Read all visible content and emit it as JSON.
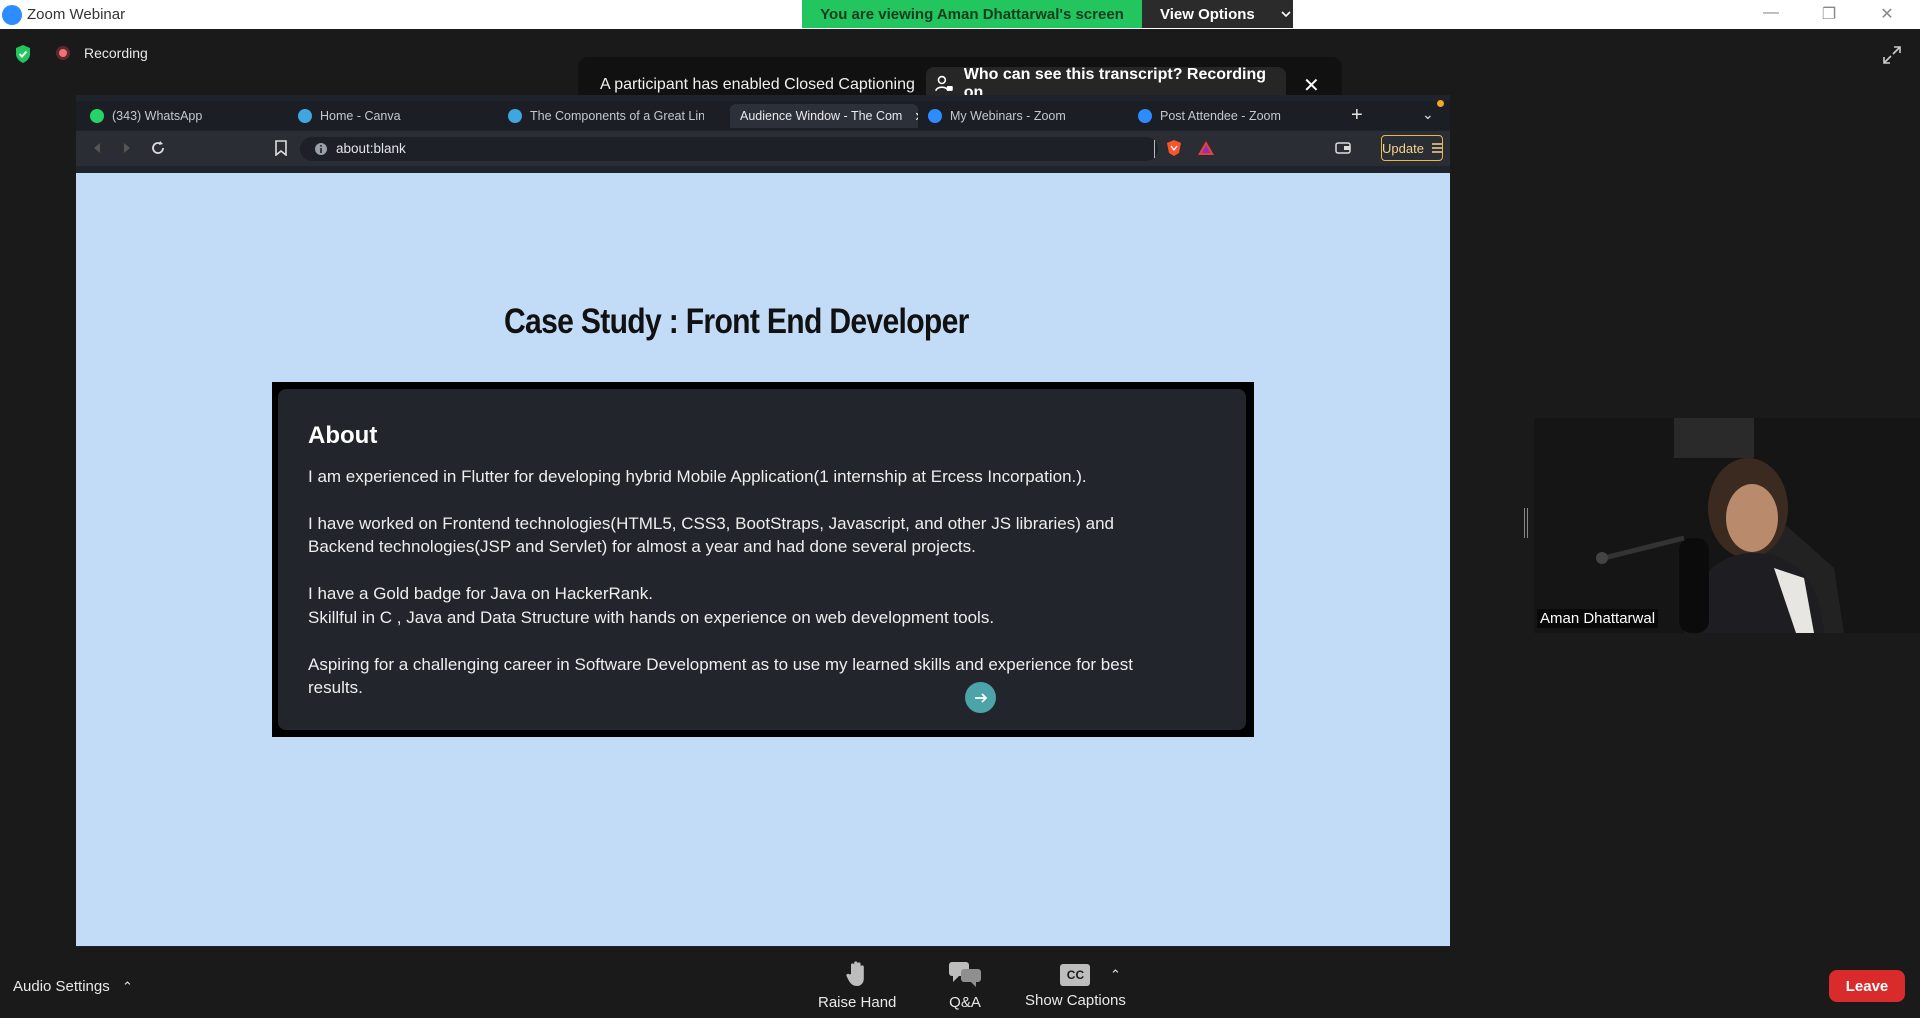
{
  "window": {
    "title": "Zoom Webinar",
    "share_banner": "You are viewing Aman Dhattarwal's screen",
    "view_options": "View Options",
    "minimize": "—",
    "restore": "❐",
    "close": "✕"
  },
  "recording": {
    "label": "Recording"
  },
  "cc_notice": {
    "message": "A participant has enabled Closed Captioning",
    "who_can_see": "Who can see this transcript? Recording on",
    "close": "✕"
  },
  "browser": {
    "tabs": [
      {
        "label": "(343) WhatsApp",
        "color": "#25d366"
      },
      {
        "label": "Home - Canva",
        "color": "#3fa7e0"
      },
      {
        "label": "The Components of a Great Link",
        "color": "#3fa7e0"
      },
      {
        "label": "Audience Window - The Com",
        "color": "#2d8cff"
      },
      {
        "label": "My Webinars - Zoom",
        "color": "#2d8cff"
      },
      {
        "label": "Post Attendee - Zoom",
        "color": "#2d8cff"
      }
    ],
    "active_tab_index": 3,
    "new_tab": "+",
    "tab_menu": "⌄",
    "address": "about:blank",
    "update_label": "Update"
  },
  "page": {
    "heading": "Case Study : Front End Developer",
    "about_title": "About",
    "lines": [
      "I am experienced in Flutter for developing hybrid Mobile Application(1 internship at Ercess Incorpation.).",
      "I have worked on Frontend technologies(HTML5, CSS3, BootStraps, Javascript, and other JS libraries) and",
      "Backend technologies(JSP and Servlet) for almost a year and had done several projects.",
      "I have a Gold badge for Java on HackerRank.",
      "Skillful in C , Java and Data Structure with hands on experience on web development tools.",
      "Aspiring for a challenging career in Software Development as to use my learned skills and experience for best",
      "results."
    ]
  },
  "video": {
    "participant_name": "Aman Dhattarwal"
  },
  "controls": {
    "audio_settings": "Audio Settings",
    "raise_hand": "Raise Hand",
    "qa": "Q&A",
    "cc_badge": "CC",
    "show_captions": "Show Captions",
    "leave": "Leave"
  },
  "colors": {
    "share_green": "#23c55e",
    "leave_red": "#d92b2b",
    "page_bg": "#c2dcf8"
  }
}
